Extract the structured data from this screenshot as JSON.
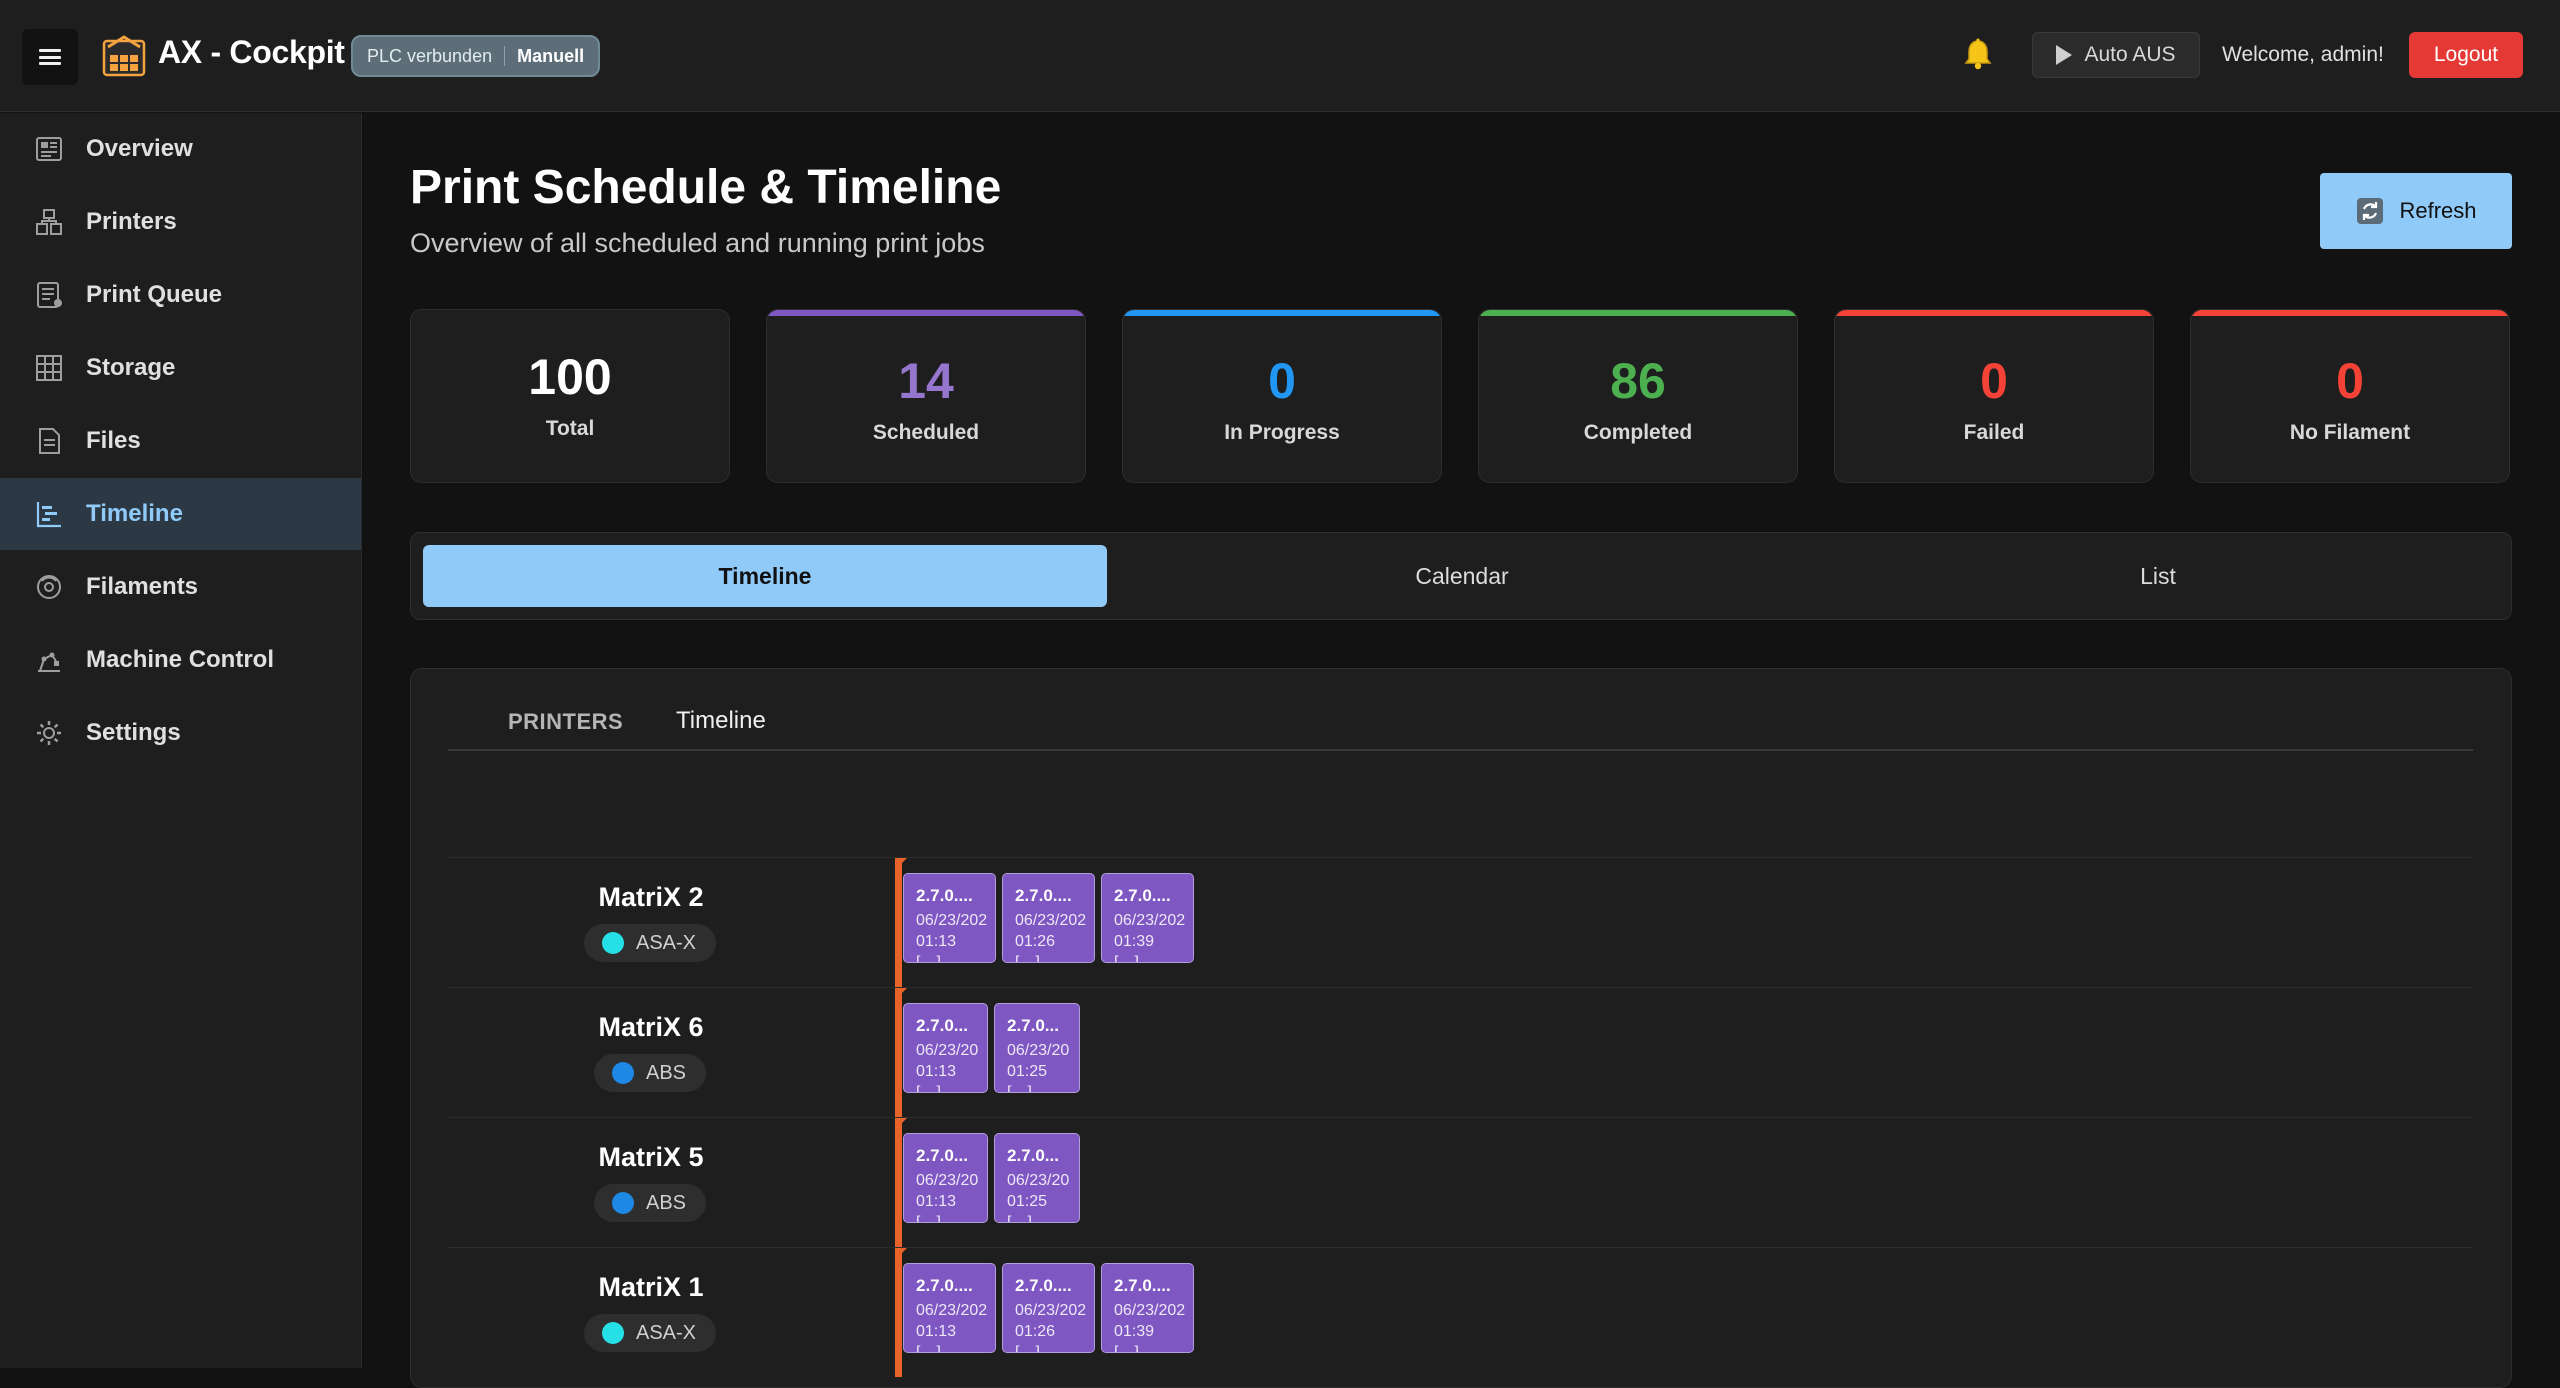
{
  "header": {
    "app_title": "AX - Cockpit",
    "plc_status": "PLC verbunden",
    "plc_mode": "Manuell",
    "auto_button": "Auto AUS",
    "welcome": "Welcome, admin!",
    "logout": "Logout"
  },
  "sidebar": {
    "items": [
      {
        "label": "Overview",
        "icon": "dashboard-icon",
        "active": false
      },
      {
        "label": "Printers",
        "icon": "printers-icon",
        "active": false
      },
      {
        "label": "Print Queue",
        "icon": "queue-icon",
        "active": false
      },
      {
        "label": "Storage",
        "icon": "storage-icon",
        "active": false
      },
      {
        "label": "Files",
        "icon": "file-icon",
        "active": false
      },
      {
        "label": "Timeline",
        "icon": "timeline-icon",
        "active": true
      },
      {
        "label": "Filaments",
        "icon": "filament-icon",
        "active": false
      },
      {
        "label": "Machine Control",
        "icon": "machine-icon",
        "active": false
      },
      {
        "label": "Settings",
        "icon": "gear-icon",
        "active": false
      }
    ]
  },
  "page": {
    "title": "Print Schedule & Timeline",
    "subtitle": "Overview of all scheduled and running print jobs",
    "refresh": "Refresh"
  },
  "stats": [
    {
      "value": "100",
      "label": "Total",
      "color": "#ffffff",
      "accent": ""
    },
    {
      "value": "14",
      "label": "Scheduled",
      "color": "#9575cd",
      "accent": "#7e57c2"
    },
    {
      "value": "0",
      "label": "In Progress",
      "color": "#2196f3",
      "accent": "#2196f3"
    },
    {
      "value": "86",
      "label": "Completed",
      "color": "#4caf50",
      "accent": "#4caf50"
    },
    {
      "value": "0",
      "label": "Failed",
      "color": "#f44336",
      "accent": "#f44336"
    },
    {
      "value": "0",
      "label": "No Filament",
      "color": "#f44336",
      "accent": "#f44336"
    }
  ],
  "tabs": [
    {
      "label": "Timeline",
      "active": true
    },
    {
      "label": "Calendar",
      "active": false
    },
    {
      "label": "List",
      "active": false
    }
  ],
  "timeline": {
    "header_printers": "PRINTERS",
    "header_timeline": "Timeline",
    "rows": [
      {
        "printer": "MatriX 2",
        "material": "ASA-X",
        "material_color": "#26e0e8",
        "jobs": [
          {
            "title": "2.7.0....",
            "date": "06/23/202",
            "time": "01:13",
            "extra": "[…]"
          },
          {
            "title": "2.7.0....",
            "date": "06/23/202",
            "time": "01:26",
            "extra": "[…]"
          },
          {
            "title": "2.7.0....",
            "date": "06/23/202",
            "time": "01:39",
            "extra": "[…]"
          }
        ]
      },
      {
        "printer": "MatriX 6",
        "material": "ABS",
        "material_color": "#1e88e5",
        "jobs": [
          {
            "title": "2.7.0...",
            "date": "06/23/20",
            "time": "01:13",
            "extra": "[…]"
          },
          {
            "title": "2.7.0...",
            "date": "06/23/20",
            "time": "01:25",
            "extra": "[…]"
          }
        ]
      },
      {
        "printer": "MatriX 5",
        "material": "ABS",
        "material_color": "#1e88e5",
        "jobs": [
          {
            "title": "2.7.0...",
            "date": "06/23/20",
            "time": "01:13",
            "extra": "[…]"
          },
          {
            "title": "2.7.0...",
            "date": "06/23/20",
            "time": "01:25",
            "extra": "[…]"
          }
        ]
      },
      {
        "printer": "MatriX 1",
        "material": "ASA-X",
        "material_color": "#26e0e8",
        "jobs": [
          {
            "title": "2.7.0....",
            "date": "06/23/202",
            "time": "01:13",
            "extra": "[…]"
          },
          {
            "title": "2.7.0....",
            "date": "06/23/202",
            "time": "01:26",
            "extra": "[…]"
          },
          {
            "title": "2.7.0....",
            "date": "06/23/202",
            "time": "01:39",
            "extra": "[…]"
          }
        ]
      }
    ]
  }
}
